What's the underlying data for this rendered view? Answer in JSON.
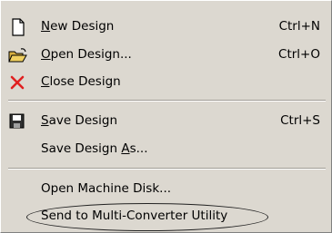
{
  "menu": {
    "items": [
      {
        "label": "New Design",
        "mnemonic_index": 0,
        "shortcut": "Ctrl+N",
        "icon": "new-document-icon"
      },
      {
        "label": "Open Design...",
        "mnemonic_index": 0,
        "shortcut": "Ctrl+O",
        "icon": "open-folder-icon"
      },
      {
        "label": "Close Design",
        "mnemonic_index": 0,
        "shortcut": "",
        "icon": "close-x-icon"
      },
      {
        "label": "Save Design",
        "mnemonic_index": 0,
        "shortcut": "Ctrl+S",
        "icon": "floppy-disk-icon"
      },
      {
        "label": "Save Design As...",
        "mnemonic_index": 12,
        "shortcut": "",
        "icon": ""
      },
      {
        "label": "Open Machine Disk...",
        "mnemonic_index": -1,
        "shortcut": "",
        "icon": ""
      },
      {
        "label": "Send to Multi-Converter Utility",
        "mnemonic_index": -1,
        "shortcut": "",
        "icon": "",
        "highlighted_with_oval": true
      }
    ]
  },
  "colors": {
    "menu_background": "#dcd8d0",
    "close_icon": "#e02020",
    "annotation_oval": "#222222"
  }
}
